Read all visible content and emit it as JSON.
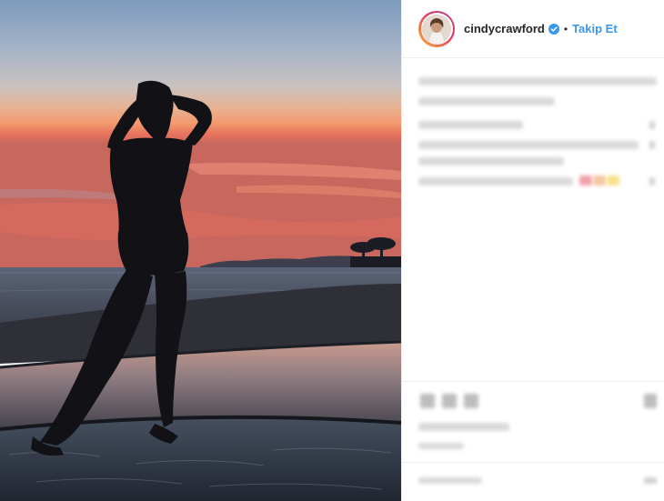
{
  "post": {
    "author": {
      "username": "cindycrawford",
      "verified": true,
      "separator": "•",
      "follow_label": "Takip Et"
    },
    "photo": {
      "description_icon": "beach-sunset-photo"
    },
    "caption": {
      "blurred": true
    },
    "comments": {
      "blurred": true
    },
    "actions": {
      "icons": [
        "heart-icon",
        "comment-icon",
        "share-icon",
        "bookmark-icon"
      ],
      "blurred": true
    }
  }
}
